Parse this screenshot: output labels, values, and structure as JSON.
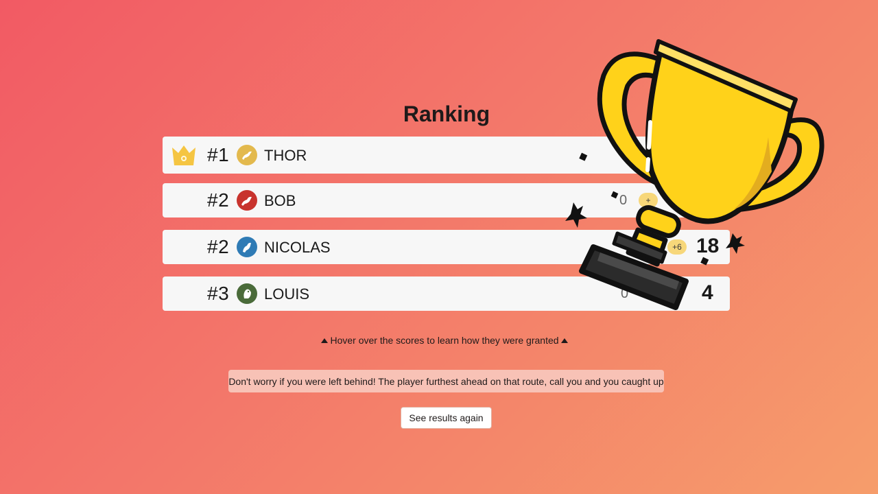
{
  "title": "Ranking",
  "players": [
    {
      "rank": "#1",
      "name": "THOR",
      "avatar_color": "#e3b94d",
      "avatar_icon": "bird-icon",
      "crown": true
    },
    {
      "rank": "#2",
      "name": "BOB",
      "avatar_color": "#c8332d",
      "avatar_icon": "crow-icon",
      "previous": "0",
      "delta": "+"
    },
    {
      "rank": "#2",
      "name": "NICOLAS",
      "avatar_color": "#2f7bb5",
      "avatar_icon": "bird-icon",
      "delta": "+6",
      "total": "18"
    },
    {
      "rank": "#3",
      "name": "LOUIS",
      "avatar_color": "#4a6b3a",
      "avatar_icon": "owl-icon",
      "previous": "0",
      "total": "4"
    }
  ],
  "hint": "Hover over the scores to learn how they were granted",
  "note": "Don't worry if you were left behind! The player furthest ahead on that route, call you and you caught up",
  "see_again_label": "See results again",
  "colors": {
    "crown": "#f5c542",
    "trophy": "#ffd21a",
    "badge": "#f7d77a"
  }
}
